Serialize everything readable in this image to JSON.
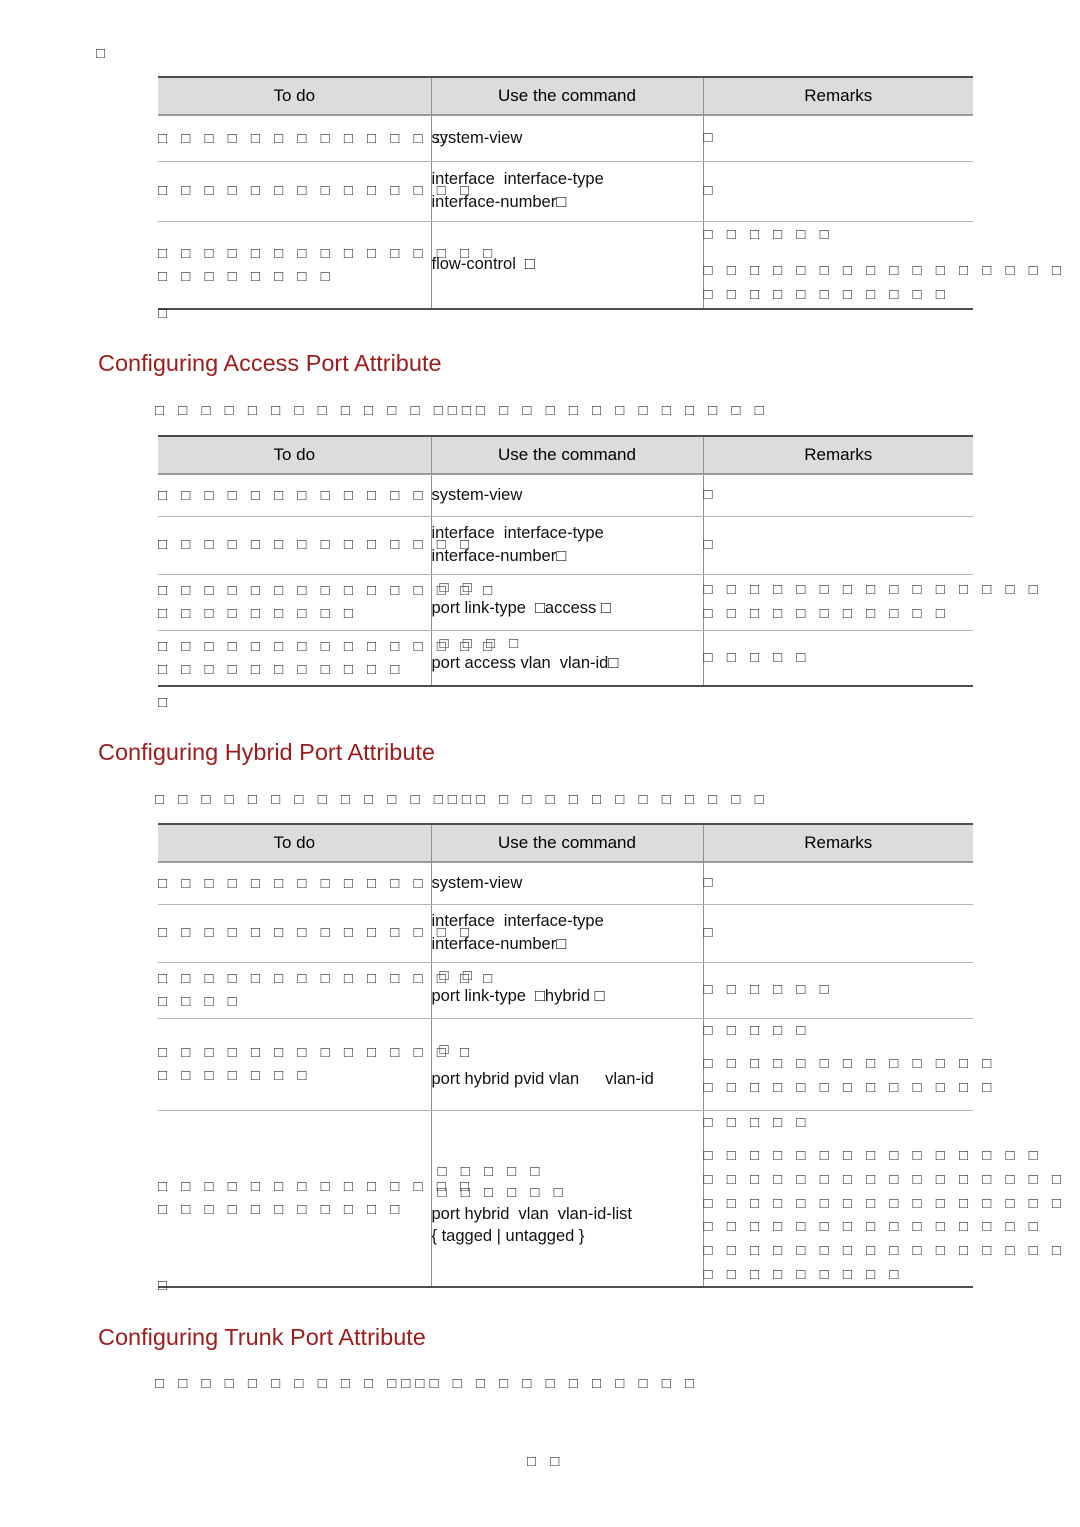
{
  "document": {
    "type": "network-switch-configuration-manual-page",
    "page_footer": "□ □",
    "top_stray_mark": "□"
  },
  "glyph_note": "Non-Latin (CJK) text renders as missing-glyph boxes in the source screenshot",
  "tables": {
    "column_headers": {
      "todo": "To do",
      "command": "Use the command",
      "remarks": "Remarks"
    },
    "flow_control": {
      "rows": [
        {
          "todo": "□ □ □ □ □ □ □ □ □ □ □ □ □",
          "command": "system-view",
          "command_suffix": "",
          "remarks": "□"
        },
        {
          "todo": "□ □ □ □ □ □ □ □ □ □ □ □ □ □",
          "command": "interface",
          "command_arg": "interface-type",
          "command_line2": "interface-number□",
          "remarks": "□"
        },
        {
          "todo_line1": "□ □ □ □ □ □ □ □ □ □ □ □ □ □ □",
          "todo_line2": "□ □ □ □ □ □ □ □",
          "command": "flow-control",
          "command_suffix": "□",
          "remarks_line1": "□ □ □ □ □ □",
          "remarks_line2": "□ □ □ □ □ □ □ □ □ □ □ □ □ □ □ □",
          "remarks_line3": "□ □ □ □ □ □ □ □ □ □ □"
        }
      ],
      "trailing_stray": "□"
    },
    "access": {
      "heading": "Configuring Access Port Attribute",
      "intro": "□ □ □ □ □ □ □ □ □ □ □ □ □□□□ □ □ □ □ □ □ □ □ □ □ □ □",
      "rows": [
        {
          "todo": "□ □ □ □ □ □ □ □ □ □ □ □",
          "command": "system-view",
          "remarks": "□"
        },
        {
          "todo": "□ □ □ □ □ □ □ □ □ □ □ □ □ □",
          "command": "interface",
          "command_arg": "interface-type",
          "command_line2": "interface-number□",
          "remarks": "□"
        },
        {
          "todo_line1": "□ □ □ □ □ □ □ □ □ □ □ □ □ □ □",
          "todo_line2": "□ □ □ □ □ □ □ □ □",
          "command_overlay": "□ □",
          "command": "port link-type",
          "command_arg": "□access □",
          "remarks_line1": "□ □ □ □ □ □ □ □ □ □ □ □ □ □ □",
          "remarks_line2": "□ □ □ □ □ □ □ □ □ □ □"
        },
        {
          "todo_line1": "□ □ □ □ □ □ □ □ □ □ □ □ □ □ □",
          "todo_line2": "□ □ □ □ □ □ □ □ □ □ □",
          "command_overlay": "□ □ □ □",
          "command": "port access vlan",
          "command_arg": "vlan-id□",
          "remarks": "□ □ □ □ □"
        }
      ],
      "trailing_stray": "□"
    },
    "hybrid": {
      "heading": "Configuring Hybrid Port Attribute",
      "intro": "□ □ □ □ □ □ □ □ □ □ □ □ □□□□ □ □ □ □ □ □ □ □ □ □ □ □",
      "rows": [
        {
          "todo": "□ □ □ □ □ □ □ □ □ □ □ □",
          "command": "system-view",
          "remarks": "□"
        },
        {
          "todo": "□ □ □ □ □ □ □ □ □ □ □ □ □ □",
          "command": "interface",
          "command_arg": "interface-type",
          "command_line2": "interface-number□",
          "remarks": "□"
        },
        {
          "todo_line1": "□ □ □ □ □ □ □ □ □ □ □ □ □ □ □",
          "todo_line2": "□ □ □ □",
          "command_overlay": "□ □",
          "command": "port link-type",
          "command_arg": "□hybrid □",
          "remarks": "□ □ □ □ □ □"
        },
        {
          "todo_line1": "□ □ □ □ □ □ □ □ □ □ □ □ □ □",
          "todo_line2": "□ □ □ □ □ □ □",
          "command_overlay": "□",
          "command": "port hybrid pvid vlan",
          "command_arg": "vlan-id",
          "remarks_line1": "□ □ □ □ □",
          "remarks_line2": "□ □ □ □ □ □ □ □ □ □ □ □ □",
          "remarks_line3": "□ □ □ □ □ □ □ □ □ □ □ □ □"
        },
        {
          "todo_line1": "□ □ □ □ □ □ □ □ □ □ □ □ □ □",
          "todo_line2": "□ □ □ □ □ □ □ □ □ □ □",
          "command_overlay1": "□ □ □ □ □",
          "command_overlay2": "□ □ □ □ □ □",
          "command": "port hybrid",
          "command_arg1": "vlan",
          "command_arg2": "vlan-id-list",
          "command_line2": "{ tagged | untagged }",
          "remarks_line1": "□ □ □ □ □",
          "remarks_line2": "□ □ □ □ □ □ □ □ □ □ □ □ □ □ □",
          "remarks_line3": "□ □ □ □ □ □ □ □ □ □ □ □ □ □ □ □",
          "remarks_line4": "□ □ □ □ □ □ □ □ □ □ □ □ □ □ □ □",
          "remarks_line5": "□ □ □ □ □ □ □ □ □ □ □ □ □ □ □",
          "remarks_line6": "□ □ □ □ □ □ □ □ □ □ □ □ □ □ □ □",
          "remarks_line7": "□ □ □ □ □ □ □ □ □"
        }
      ],
      "trailing_stray": "□"
    },
    "trunk": {
      "heading": "Configuring Trunk Port Attribute",
      "intro": "□ □ □ □ □ □ □ □ □ □ □□□□ □ □ □ □ □ □ □ □ □ □ □"
    }
  }
}
